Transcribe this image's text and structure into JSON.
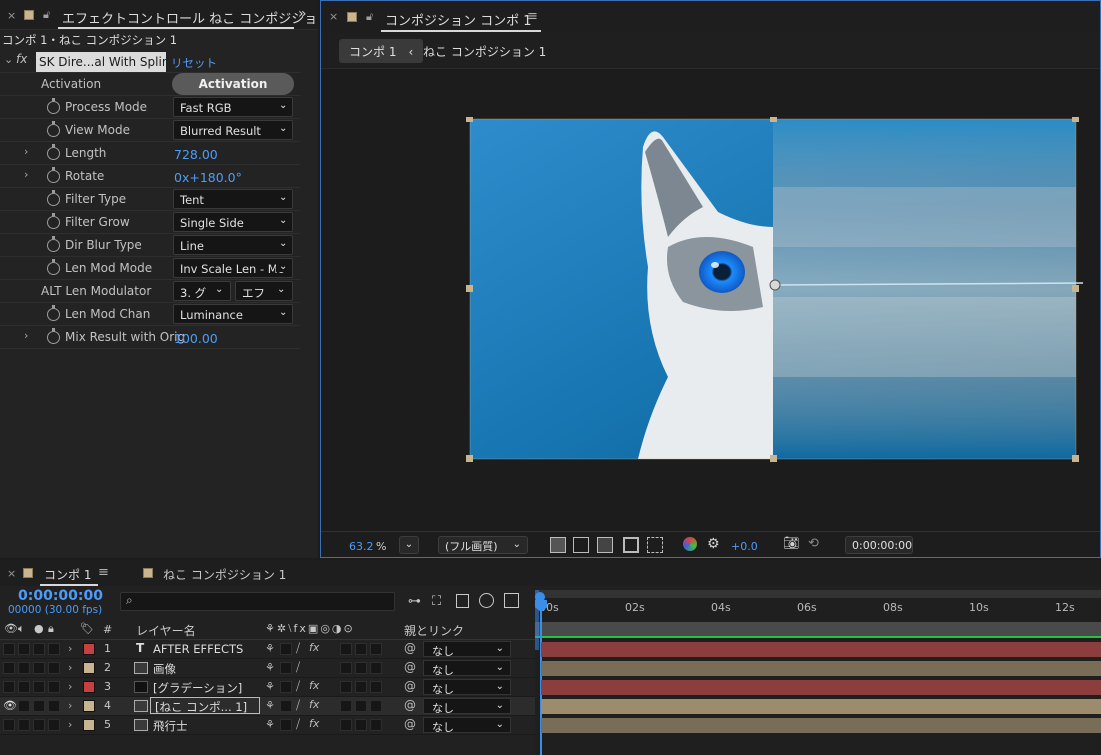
{
  "effect_controls": {
    "tab_title": "エフェクトコントロール ねこ コンポジショ",
    "breadcrumb": "コンポ 1・ねこ コンポジション 1",
    "effect_name": "SK Dire...al With Splines",
    "reset_label": "リセット",
    "fx_label": "fx",
    "activation_label": "Activation",
    "activation_button": "Activation",
    "props": [
      {
        "label": "Process Mode",
        "value": "Fast RGB",
        "kind": "dropdown"
      },
      {
        "label": "View Mode",
        "value": "Blurred Result",
        "kind": "dropdown"
      },
      {
        "label": "Length",
        "value": "728.00",
        "kind": "value"
      },
      {
        "label": "Rotate",
        "value": "0x+180.0°",
        "kind": "value"
      },
      {
        "label": "Filter Type",
        "value": "Tent",
        "kind": "dropdown"
      },
      {
        "label": "Filter Grow",
        "value": "Single Side",
        "kind": "dropdown"
      },
      {
        "label": "Dir Blur Type",
        "value": "Line",
        "kind": "dropdown"
      },
      {
        "label": "Len Mod Mode",
        "value": "Inv Scale Len - Mo",
        "kind": "dropdown"
      },
      {
        "label": "ALT Len Modulator",
        "value": "3. グ",
        "value2": "エフ",
        "kind": "double"
      },
      {
        "label": "Len Mod Chan",
        "value": "Luminance",
        "kind": "dropdown"
      },
      {
        "label": "Mix Result with Orig",
        "value": "100.00",
        "kind": "value"
      }
    ]
  },
  "composition": {
    "tab_title": "コンポジション コンポ 1",
    "crumb_button": "コンポ 1",
    "crumb_current": "ねこ コンポジション 1",
    "zoom": "63.2",
    "zoom_unit": "%",
    "quality": "(フル画質)",
    "exposure": "+0.0",
    "timecode": "0:00:00:00"
  },
  "timeline": {
    "tab_active": "コンポ 1",
    "tab_other": "ねこ コンポジション 1",
    "current_time": "0:00:00:00",
    "frame_info": "00000 (30.00 fps)",
    "search_placeholder": "",
    "col_hash": "#",
    "col_layer_name": "レイヤー名",
    "col_parent": "親とリンク",
    "ruler": [
      "00s",
      "02s",
      "04s",
      "06s",
      "08s",
      "10s",
      "12s"
    ],
    "layers": [
      {
        "num": "1",
        "name": "AFTER EFFECTS",
        "type": "T",
        "label_color": "#c74040",
        "parent": "なし",
        "bar_color": "#8c3e3e",
        "visible": false
      },
      {
        "num": "2",
        "name": "画像",
        "type": "img",
        "label_color": "#c8b48e",
        "parent": "なし",
        "bar_color": "#7a6d58",
        "visible": false
      },
      {
        "num": "3",
        "name": "[グラデーション]",
        "type": "solid",
        "label_color": "#c74040",
        "parent": "なし",
        "bar_color": "#8c3e3e",
        "visible": false
      },
      {
        "num": "4",
        "name": "[ねこ コンポ... 1]",
        "type": "comp",
        "label_color": "#c8b48e",
        "parent": "なし",
        "bar_color": "#9c8b6c",
        "visible": true
      },
      {
        "num": "5",
        "name": "飛行士",
        "type": "img",
        "label_color": "#c8b48e",
        "parent": "なし",
        "bar_color": "#7a6d58",
        "visible": false
      }
    ]
  },
  "colors": {
    "accent_blue": "#4e9cf6",
    "panel_border": "#3b6fb8"
  }
}
